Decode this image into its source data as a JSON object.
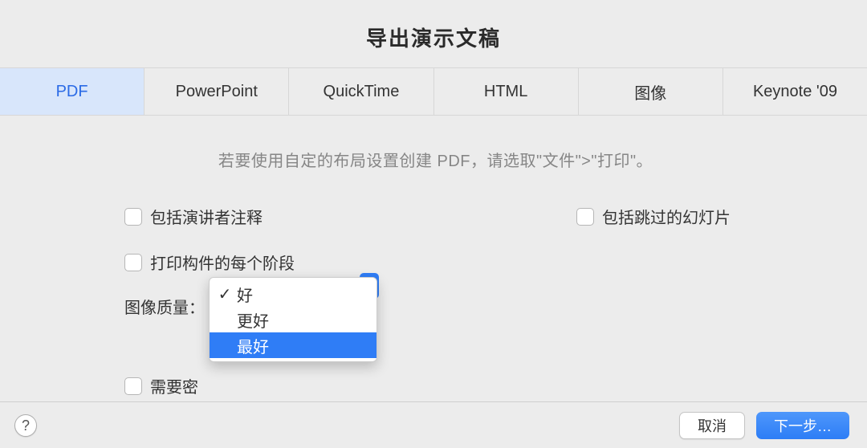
{
  "dialog": {
    "title": "导出演示文稿"
  },
  "tabs": [
    {
      "label": "PDF"
    },
    {
      "label": "PowerPoint"
    },
    {
      "label": "QuickTime"
    },
    {
      "label": "HTML"
    },
    {
      "label": "图像"
    },
    {
      "label": "Keynote '09"
    }
  ],
  "hint": "若要使用自定的布局设置创建 PDF，请选取\"文件\">\"打印\"。",
  "checkboxes": {
    "presenter_notes": "包括演讲者注释",
    "skipped_slides": "包括跳过的幻灯片",
    "print_builds": "打印构件的每个阶段",
    "require_password": "需要密"
  },
  "quality": {
    "label": "图像质量：",
    "options": [
      {
        "label": "好",
        "checked": true
      },
      {
        "label": "更好",
        "checked": false
      },
      {
        "label": "最好",
        "checked": false
      }
    ],
    "selected_index": 0,
    "highlighted_index": 2
  },
  "footer": {
    "help": "?",
    "cancel": "取消",
    "next": "下一步…"
  }
}
